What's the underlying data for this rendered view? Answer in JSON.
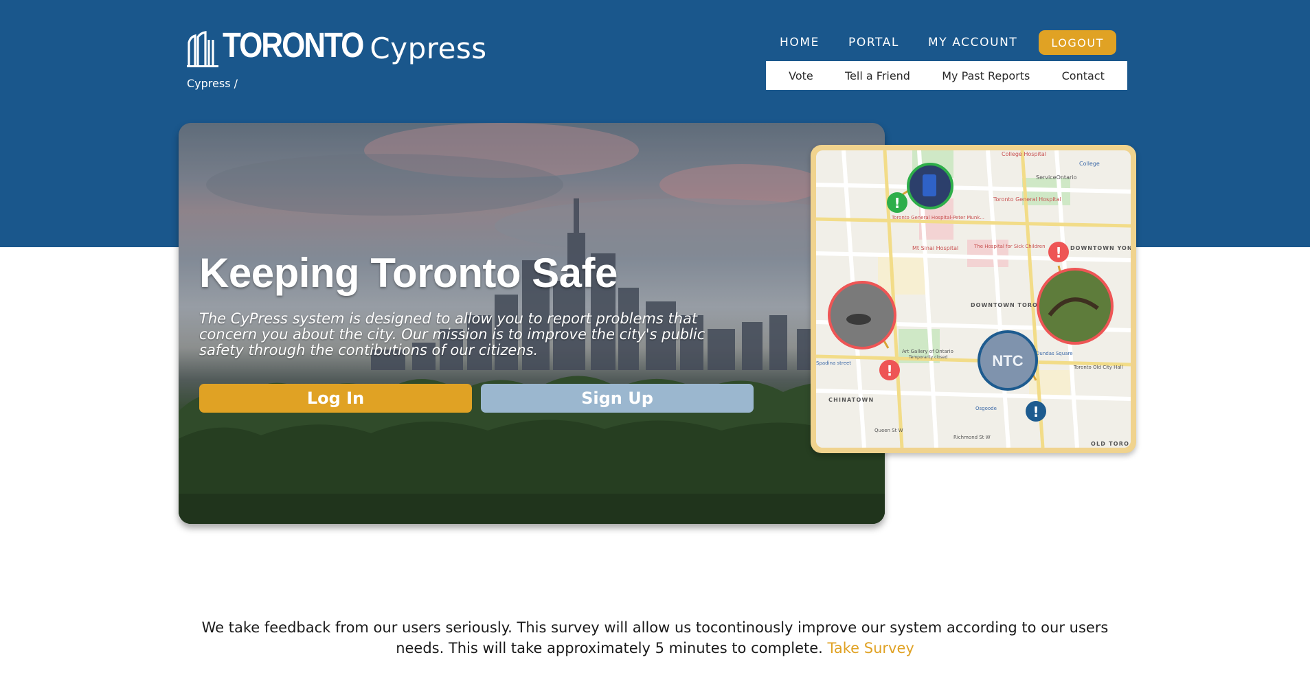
{
  "brand": {
    "city": "TORONTO",
    "name": "Cypress"
  },
  "breadcrumb": "Cypress /",
  "nav": {
    "primary": [
      "HOME",
      "PORTAL",
      "MY ACCOUNT"
    ],
    "logout": "LOGOUT",
    "secondary": [
      "Vote",
      "Tell a Friend",
      "My Past Reports",
      "Contact"
    ]
  },
  "hero": {
    "title": "Keeping Toronto Safe",
    "description": "The CyPress system is designed to allow you to report problems that concern you about the city. Our mission is to improve the city's public safety through the contibutions of our citizens.",
    "login_label": "Log In",
    "signup_label": "Sign Up"
  },
  "map": {
    "labels": {
      "college_hospital": "College Hospital",
      "service_ontario": "ServiceOntario",
      "college": "College",
      "toronto_general_hospital": "Toronto General Hospital",
      "toronto_general_peter_munk": "Toronto General Hospital-Peter Munk...",
      "mt_sinai": "Mt Sinai Hospital",
      "sick_children": "The Hospital for Sick Children",
      "downtown_yonge": "DOWNTOWN YONGE",
      "downtown_toronto": "DOWNTOWN TORONTO",
      "art_gallery": "Art Gallery of Ontario",
      "temporarily_closed": "Temporarily closed",
      "chinatown": "CHINATOWN",
      "spadina": "Spadina street",
      "osgoode": "Osgoode",
      "dundas_square": "Dundas Square",
      "old_city_hall": "Toronto Old City Hall",
      "queen_st": "Queen St W",
      "richmond_st": "Richmond St W",
      "old_toronto": "OLD TORO"
    },
    "marker_colors": {
      "green": "#2eae4a",
      "red": "#ee5555",
      "blue": "#1d5b8f",
      "ring_gold": "#d8a436"
    }
  },
  "survey": {
    "text": "We take feedback from our users seriously. This survey will allow us tocontinously improve our system according to our users needs. This will take approximately 5 minutes to complete.",
    "link_label": "Take Survey"
  },
  "colors": {
    "brand_blue": "#1a578c",
    "accent_gold": "#e0a224",
    "signup_blue": "#9bb7cf"
  }
}
